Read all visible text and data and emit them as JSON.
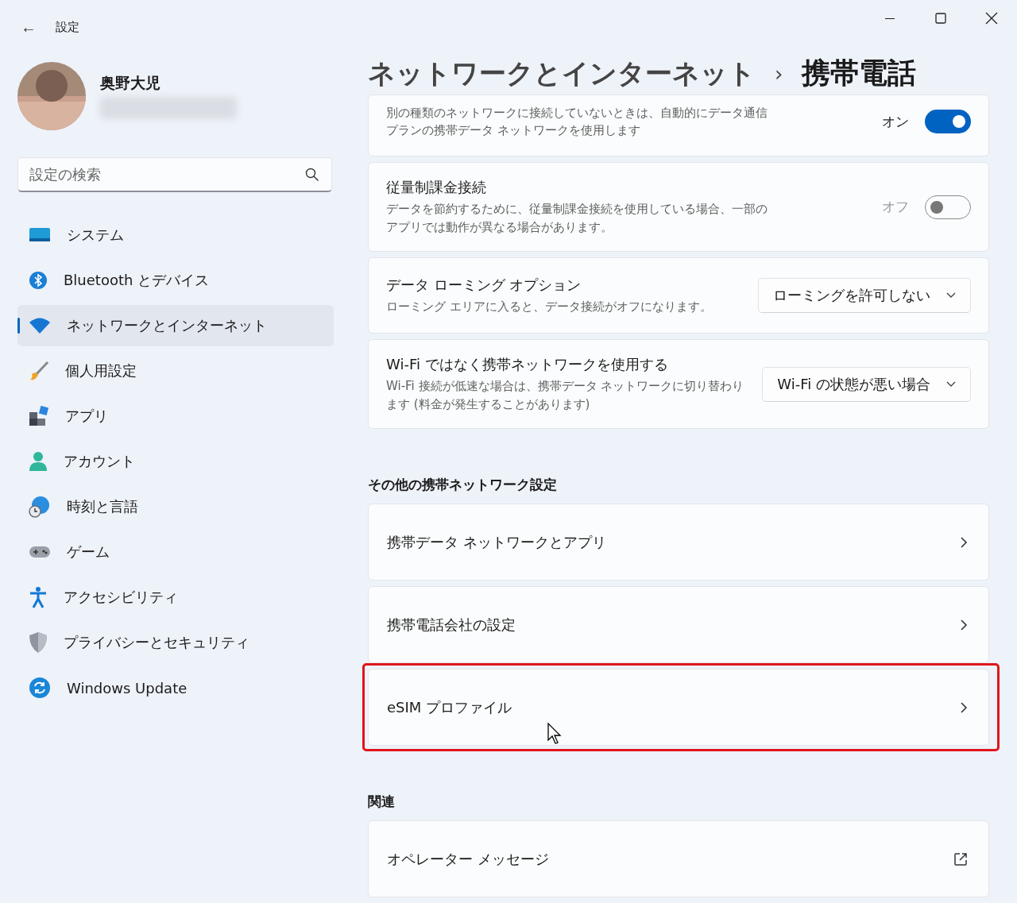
{
  "window": {
    "title": "設定",
    "back": "←"
  },
  "account": {
    "name": "奥野大児"
  },
  "search": {
    "placeholder": "設定の検索"
  },
  "sidebar": {
    "items": [
      {
        "label": "システム",
        "selected": false
      },
      {
        "label": "Bluetooth とデバイス",
        "selected": false
      },
      {
        "label": "ネットワークとインターネット",
        "selected": true
      },
      {
        "label": "個人用設定",
        "selected": false
      },
      {
        "label": "アプリ",
        "selected": false
      },
      {
        "label": "アカウント",
        "selected": false
      },
      {
        "label": "時刻と言語",
        "selected": false
      },
      {
        "label": "ゲーム",
        "selected": false
      },
      {
        "label": "アクセシビリティ",
        "selected": false
      },
      {
        "label": "プライバシーとセキュリティ",
        "selected": false
      },
      {
        "label": "Windows Update",
        "selected": false
      }
    ]
  },
  "breadcrumb": {
    "parent": "ネットワークとインターネット",
    "separator": "›",
    "current": "携帯電話"
  },
  "settings": [
    {
      "kind": "toggle",
      "description": "別の種類のネットワークに接続していないときは、自動的にデータ通信プランの携帯データ ネットワークを使用します",
      "on": true,
      "state_label": "オン"
    },
    {
      "kind": "toggle",
      "title": "従量制課金接続",
      "description": "データを節約するために、従量制課金接続を使用している場合、一部のアプリでは動作が異なる場合があります。",
      "on": false,
      "state_label": "オフ"
    },
    {
      "kind": "dropdown",
      "title": "データ ローミング オプション",
      "description": "ローミング エリアに入ると、データ接続がオフになります。",
      "value": "ローミングを許可しない"
    },
    {
      "kind": "dropdown",
      "title": "Wi-Fi ではなく携帯ネットワークを使用する",
      "description": "Wi-Fi 接続が低速な場合は、携帯データ ネットワークに切り替わります (料金が発生することがあります)",
      "value": "Wi-Fi の状態が悪い場合"
    }
  ],
  "sections": [
    {
      "heading": "その他の携帯ネットワーク設定",
      "links": [
        {
          "kind": "link",
          "title": "携帯データ ネットワークとアプリ",
          "highlighted": false
        },
        {
          "kind": "link",
          "title": "携帯電話会社の設定",
          "highlighted": false
        },
        {
          "kind": "link",
          "title": "eSIM プロファイル",
          "highlighted": true
        }
      ]
    },
    {
      "heading": "関連",
      "links": [
        {
          "kind": "external",
          "title": "オペレーター メッセージ",
          "highlighted": false
        }
      ]
    }
  ]
}
